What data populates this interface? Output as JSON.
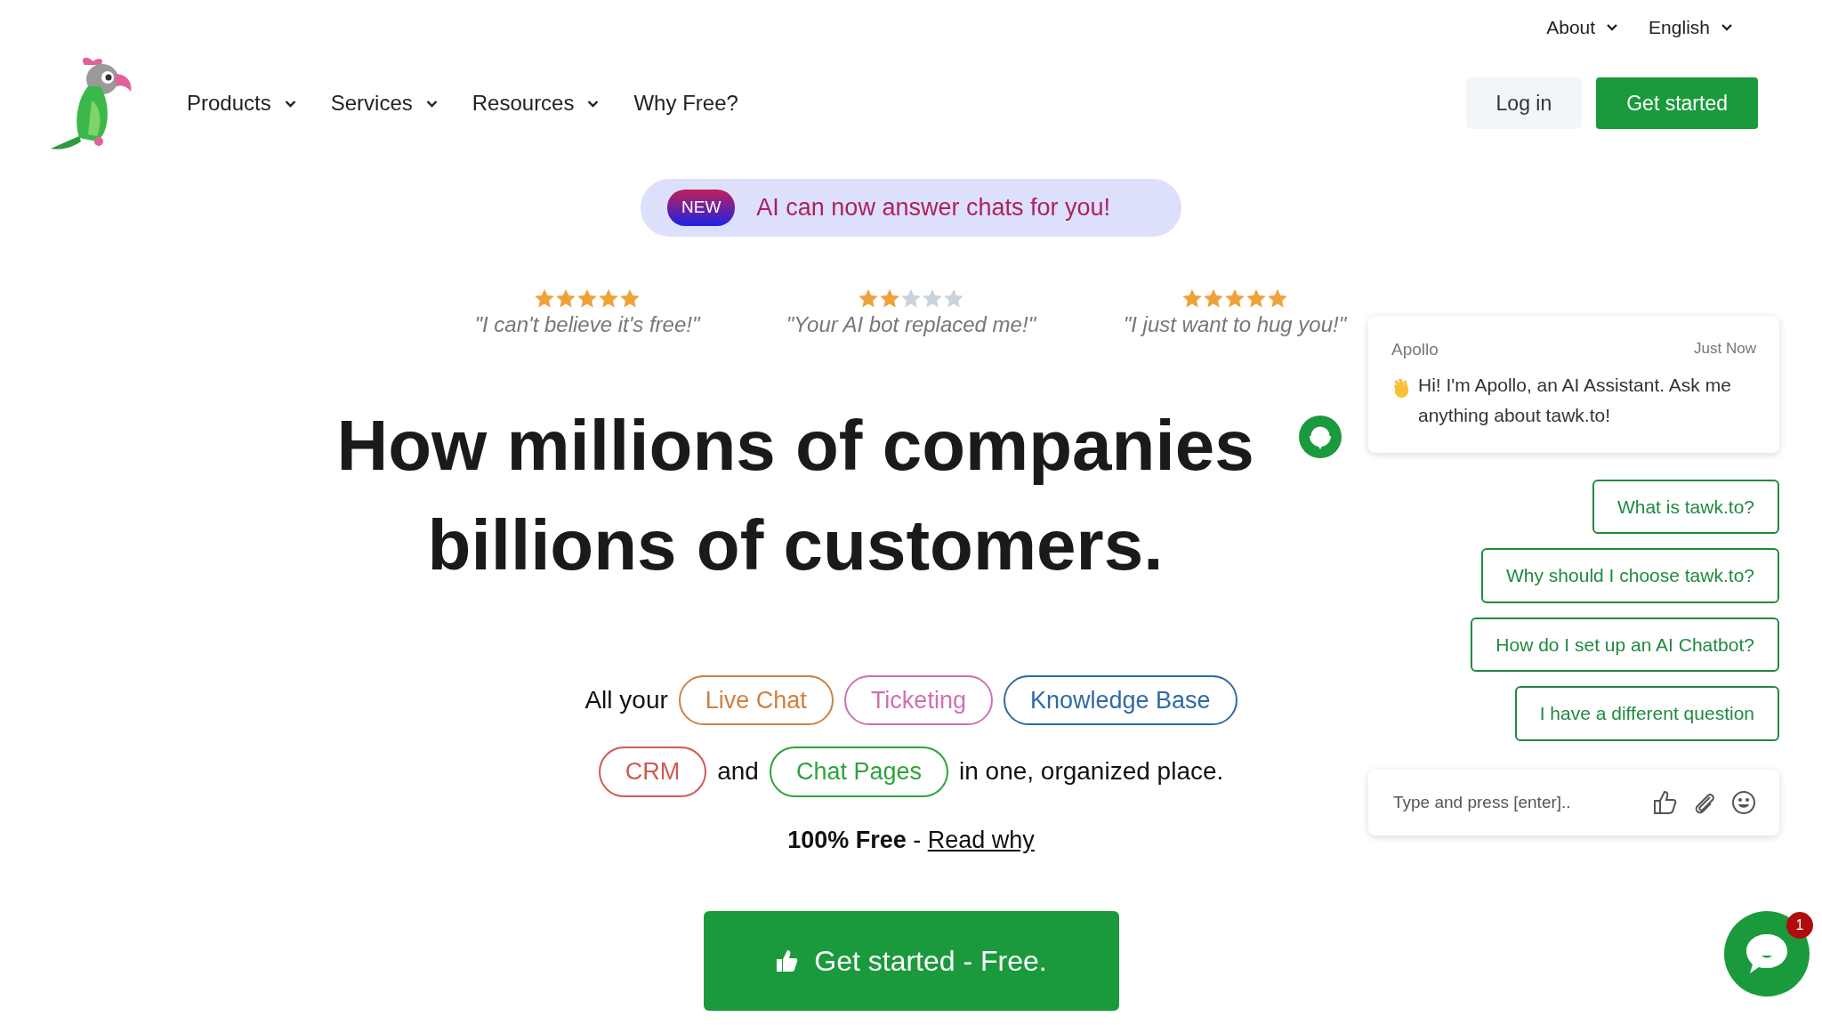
{
  "top_links": [
    {
      "label": "About",
      "dropdown": true
    },
    {
      "label": "English",
      "dropdown": true
    }
  ],
  "nav": {
    "items": [
      {
        "label": "Products",
        "dropdown": true
      },
      {
        "label": "Services",
        "dropdown": true
      },
      {
        "label": "Resources",
        "dropdown": true
      },
      {
        "label": "Why Free?",
        "dropdown": false
      }
    ],
    "login": "Log in",
    "signup": "Get started"
  },
  "announcement": {
    "badge": "NEW",
    "text": "AI can now answer chats for you!"
  },
  "reviews": [
    {
      "stars": 5,
      "quote": "\"I can't believe it's free!\""
    },
    {
      "stars": 2,
      "quote": "\"Your AI bot replaced me!\""
    },
    {
      "stars": 5,
      "quote": "\"I just want to hug you!\""
    }
  ],
  "headline": [
    "How millions of companies",
    "billions of customers."
  ],
  "products_line": [
    {
      "kind": "text",
      "text": "All your"
    },
    {
      "kind": "tag",
      "text": "Live Chat",
      "color": "#d0803f"
    },
    {
      "kind": "tag",
      "text": "Ticketing",
      "color": "#d071b0"
    },
    {
      "kind": "tag",
      "text": "Knowledge Base",
      "color": "#2f6aa6"
    },
    {
      "kind": "break"
    },
    {
      "kind": "tag",
      "text": "CRM",
      "color": "#d05a52"
    },
    {
      "kind": "text",
      "text": "and"
    },
    {
      "kind": "tag",
      "text": "Chat Pages",
      "color": "#2ea33c"
    },
    {
      "kind": "text",
      "text": "in one, organized place."
    }
  ],
  "free_line": {
    "text": "**100% Free** -",
    "link": "Read why"
  },
  "cta": "Get started - Free.",
  "chat": {
    "agent": "Apollo",
    "time": "Just Now",
    "message": "Hi! I'm Apollo, an AI Assistant. Ask me anything about tawk.to!",
    "suggestions": [
      "What is tawk.to?",
      "Why should I choose tawk.to?",
      "How do I set up an AI Chatbot?",
      "I have a different question"
    ],
    "placeholder": "Type and press [enter]..",
    "unread": "1"
  }
}
